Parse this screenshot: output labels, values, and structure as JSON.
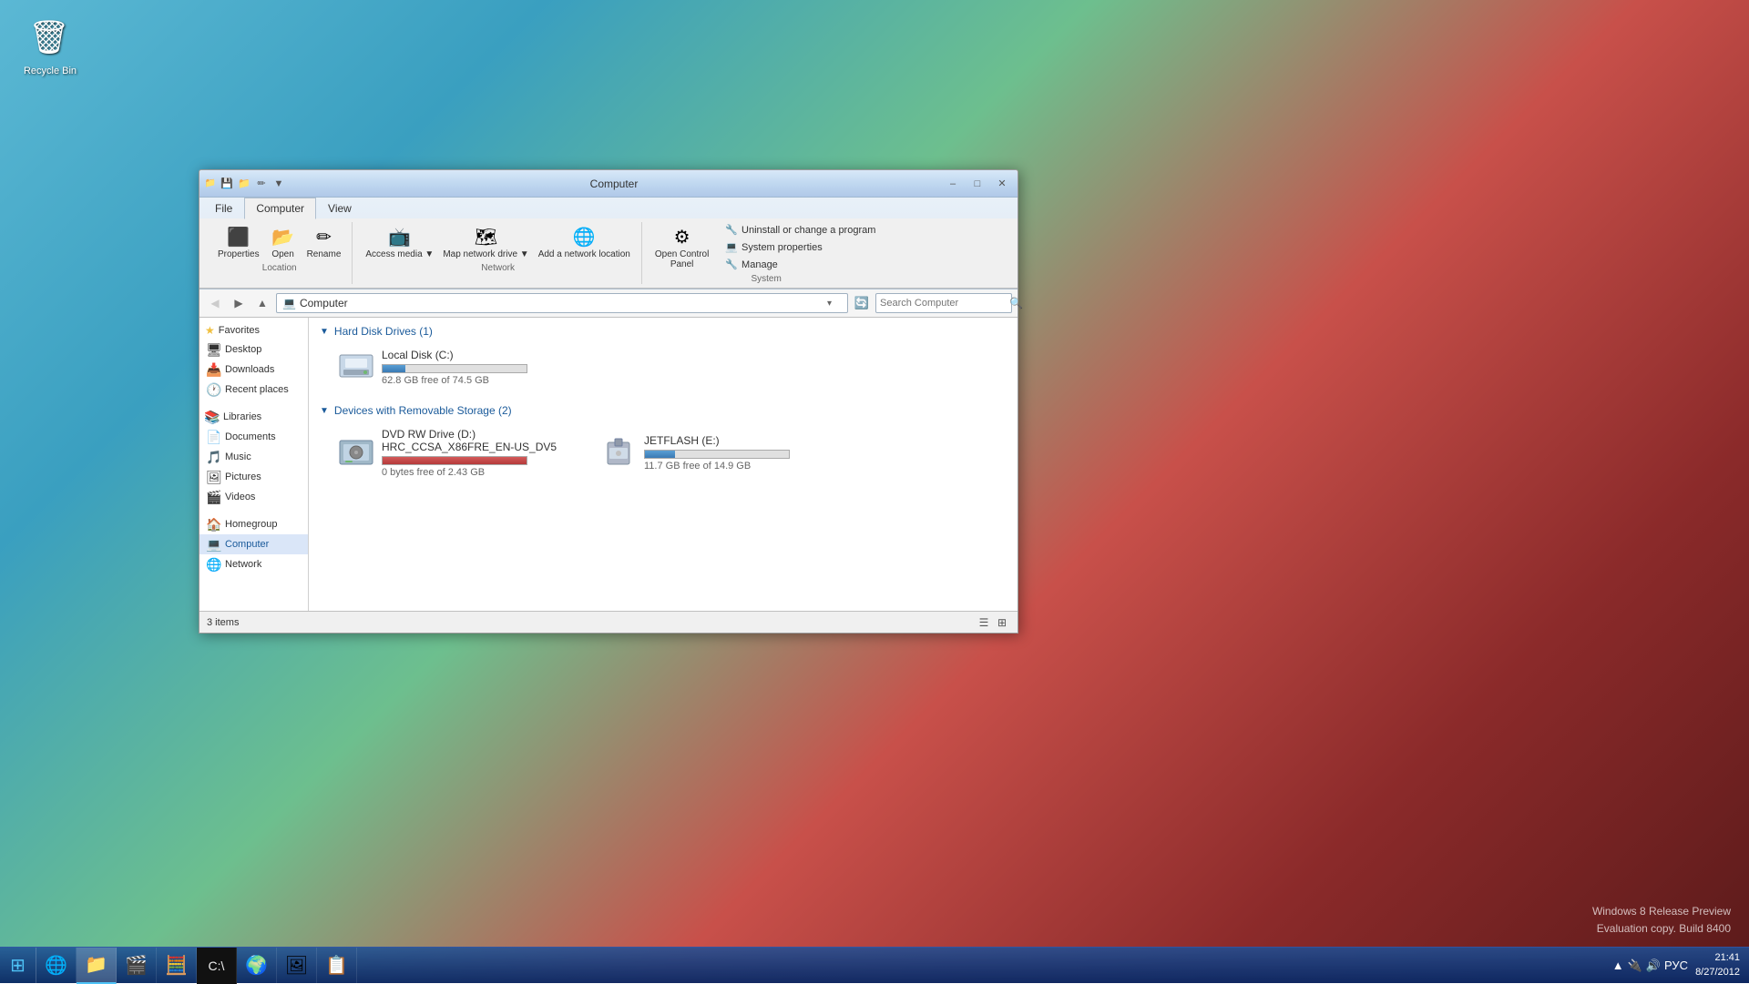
{
  "desktop": {
    "background_desc": "Windows 8 tulip wallpaper"
  },
  "recycle_bin": {
    "label": "Recycle Bin",
    "icon": "🗑"
  },
  "taskbar": {
    "items": [
      {
        "name": "internet-explorer",
        "icon": "🌐"
      },
      {
        "name": "file-explorer",
        "icon": "📁"
      },
      {
        "name": "media-player",
        "icon": "🎬"
      },
      {
        "name": "calculator",
        "icon": "🧮"
      },
      {
        "name": "cmd",
        "icon": "💻"
      },
      {
        "name": "ie-app",
        "icon": "🌍"
      },
      {
        "name": "photos",
        "icon": "🖼"
      },
      {
        "name": "task-manager",
        "icon": "🔧"
      }
    ],
    "sys_icons": [
      "▲",
      "🔌",
      "📶",
      "🔊",
      "РУС"
    ],
    "time": "21:41",
    "date": "8/27/2012",
    "watermark_line1": "Windows 8 Release Preview",
    "watermark_line2": "Evaluation copy. Build 8400"
  },
  "window": {
    "title": "Computer",
    "qat": {
      "save_btn": "💾",
      "folder_btn": "📁",
      "down_btn": "▼"
    }
  },
  "ribbon": {
    "tabs": [
      {
        "label": "File",
        "active": false
      },
      {
        "label": "Computer",
        "active": true
      },
      {
        "label": "View",
        "active": false
      }
    ],
    "groups": {
      "location": {
        "label": "Location",
        "buttons": [
          {
            "label": "Properties",
            "icon": "⬜"
          },
          {
            "label": "Open",
            "icon": "📂"
          },
          {
            "label": "Rename",
            "icon": "✏"
          }
        ]
      },
      "network": {
        "label": "Network",
        "buttons": [
          {
            "label": "Access media ▼",
            "icon": "📺"
          },
          {
            "label": "Map network drive ▼",
            "icon": "🗺"
          },
          {
            "label": "Add a network location",
            "icon": "🌐"
          }
        ]
      },
      "system": {
        "label": "System",
        "buttons": [
          {
            "label": "Open Control Panel",
            "icon": "⚙"
          },
          {
            "label": "Uninstall or change a program",
            "icon": "🔧"
          },
          {
            "label": "System properties",
            "icon": "💻"
          },
          {
            "label": "Manage",
            "icon": "🔧"
          }
        ]
      }
    }
  },
  "address_bar": {
    "path": "Computer",
    "search_placeholder": "Search Computer"
  },
  "sidebar": {
    "favorites": {
      "header": "Favorites",
      "items": [
        {
          "label": "Desktop",
          "icon": "🖥"
        },
        {
          "label": "Downloads",
          "icon": "📥"
        },
        {
          "label": "Recent places",
          "icon": "🕐"
        }
      ]
    },
    "libraries": {
      "header": "Libraries",
      "items": [
        {
          "label": "Documents",
          "icon": "📄"
        },
        {
          "label": "Music",
          "icon": "🎵"
        },
        {
          "label": "Pictures",
          "icon": "🖼"
        },
        {
          "label": "Videos",
          "icon": "🎬"
        }
      ]
    },
    "computer": {
      "label": "Computer",
      "icon": "💻"
    },
    "homegroup": {
      "label": "Homegroup",
      "icon": "🏠"
    },
    "network": {
      "label": "Network",
      "icon": "🌐"
    }
  },
  "content": {
    "hard_disk": {
      "section_label": "Hard Disk Drives (1)",
      "drives": [
        {
          "name": "Local Disk (C:)",
          "icon": "💾",
          "free": "62.8 GB free of 74.5 GB",
          "bar_pct": 16,
          "bar_type": "normal"
        }
      ]
    },
    "removable": {
      "section_label": "Devices with Removable Storage (2)",
      "drives": [
        {
          "name": "DVD RW Drive (D:)\nHRC_CCSA_X86FRE_EN-US_DV5",
          "name_line1": "DVD RW Drive (D:)",
          "name_line2": "HRC_CCSA_X86FRE_EN-US_DV5",
          "icon": "💿",
          "free": "0 bytes free of 2.43 GB",
          "bar_pct": 100,
          "bar_type": "full"
        },
        {
          "name": "JETFLASH (E:)",
          "name_line1": "JETFLASH (E:)",
          "name_line2": "",
          "icon": "💽",
          "free": "11.7 GB free of 14.9 GB",
          "bar_pct": 21,
          "bar_type": "normal"
        }
      ]
    },
    "status": "3 items"
  }
}
